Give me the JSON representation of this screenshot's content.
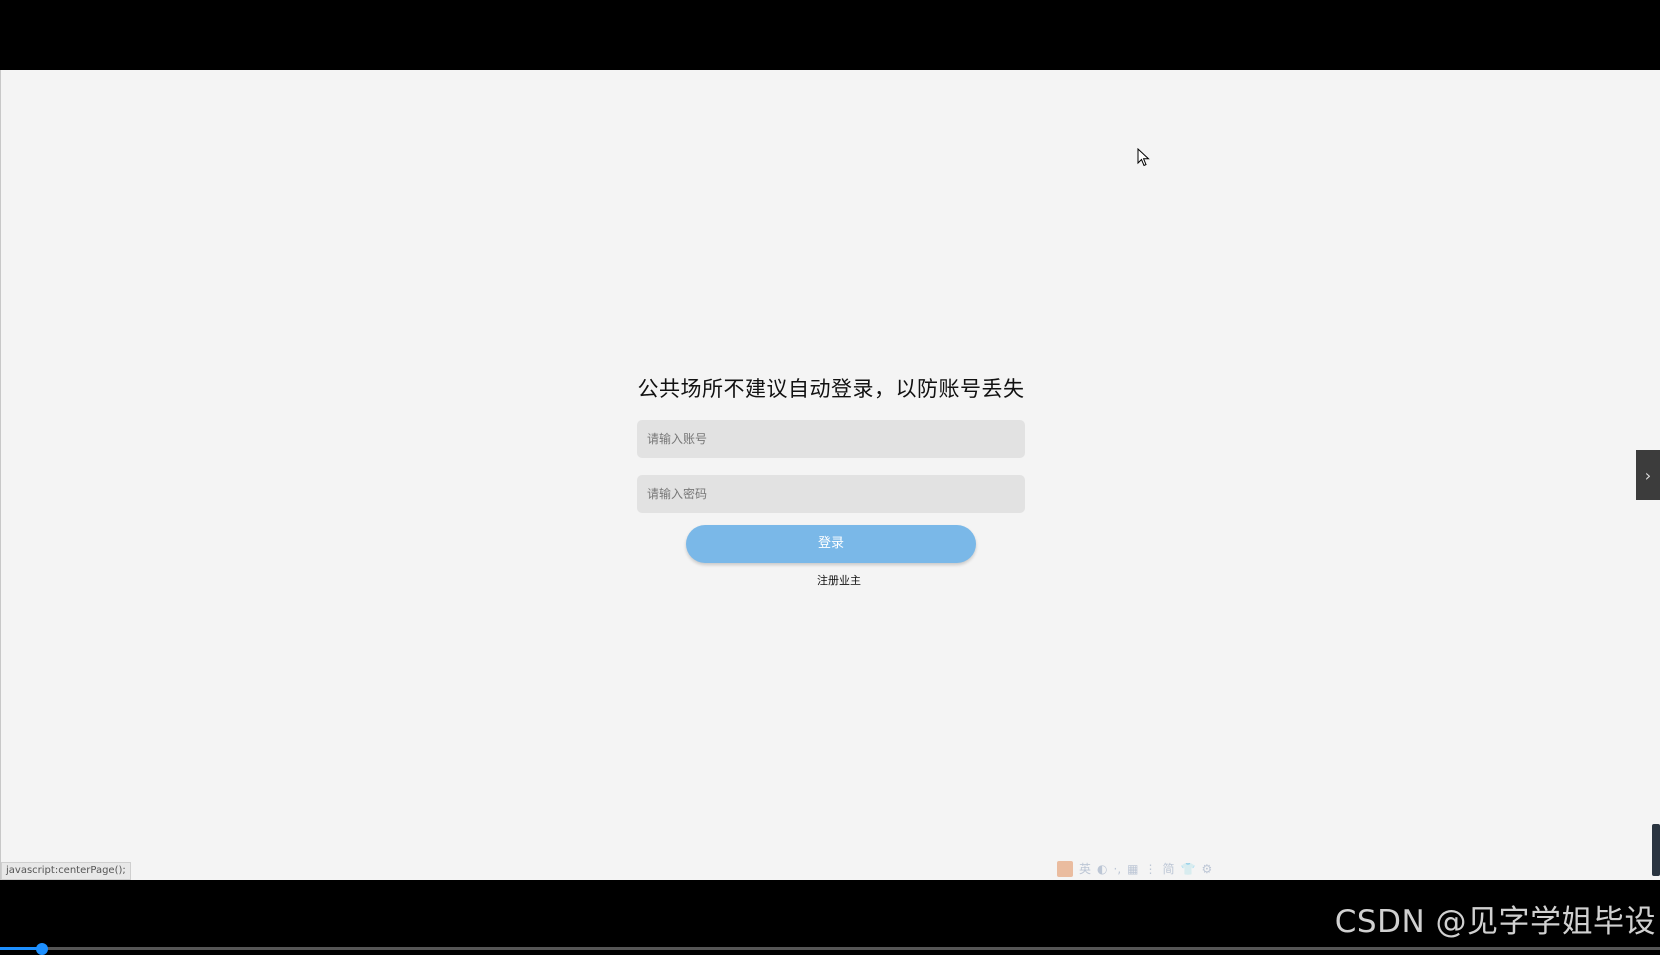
{
  "login": {
    "title": "公共场所不建议自动登录，以防账号丢失",
    "account_placeholder": "请输入账号",
    "password_placeholder": "请输入密码",
    "login_button": "登录",
    "register_link": "注册业主"
  },
  "status_bar": {
    "url": "javascript:centerPage();"
  },
  "side_toggle": {
    "glyph": "›"
  },
  "ime_toolbar": {
    "items": [
      "英",
      "◐",
      "·,",
      "▦",
      "⋮",
      "简",
      "👕",
      "⚙"
    ]
  },
  "video": {
    "progress_fraction": 0.025
  },
  "watermark": {
    "text": "CSDN @见字学姐毕设"
  },
  "colors": {
    "page_background": "#f4f4f4",
    "input_background": "#e2e2e2",
    "login_button": "#7ab8e8",
    "progress": "#1e90ff"
  }
}
